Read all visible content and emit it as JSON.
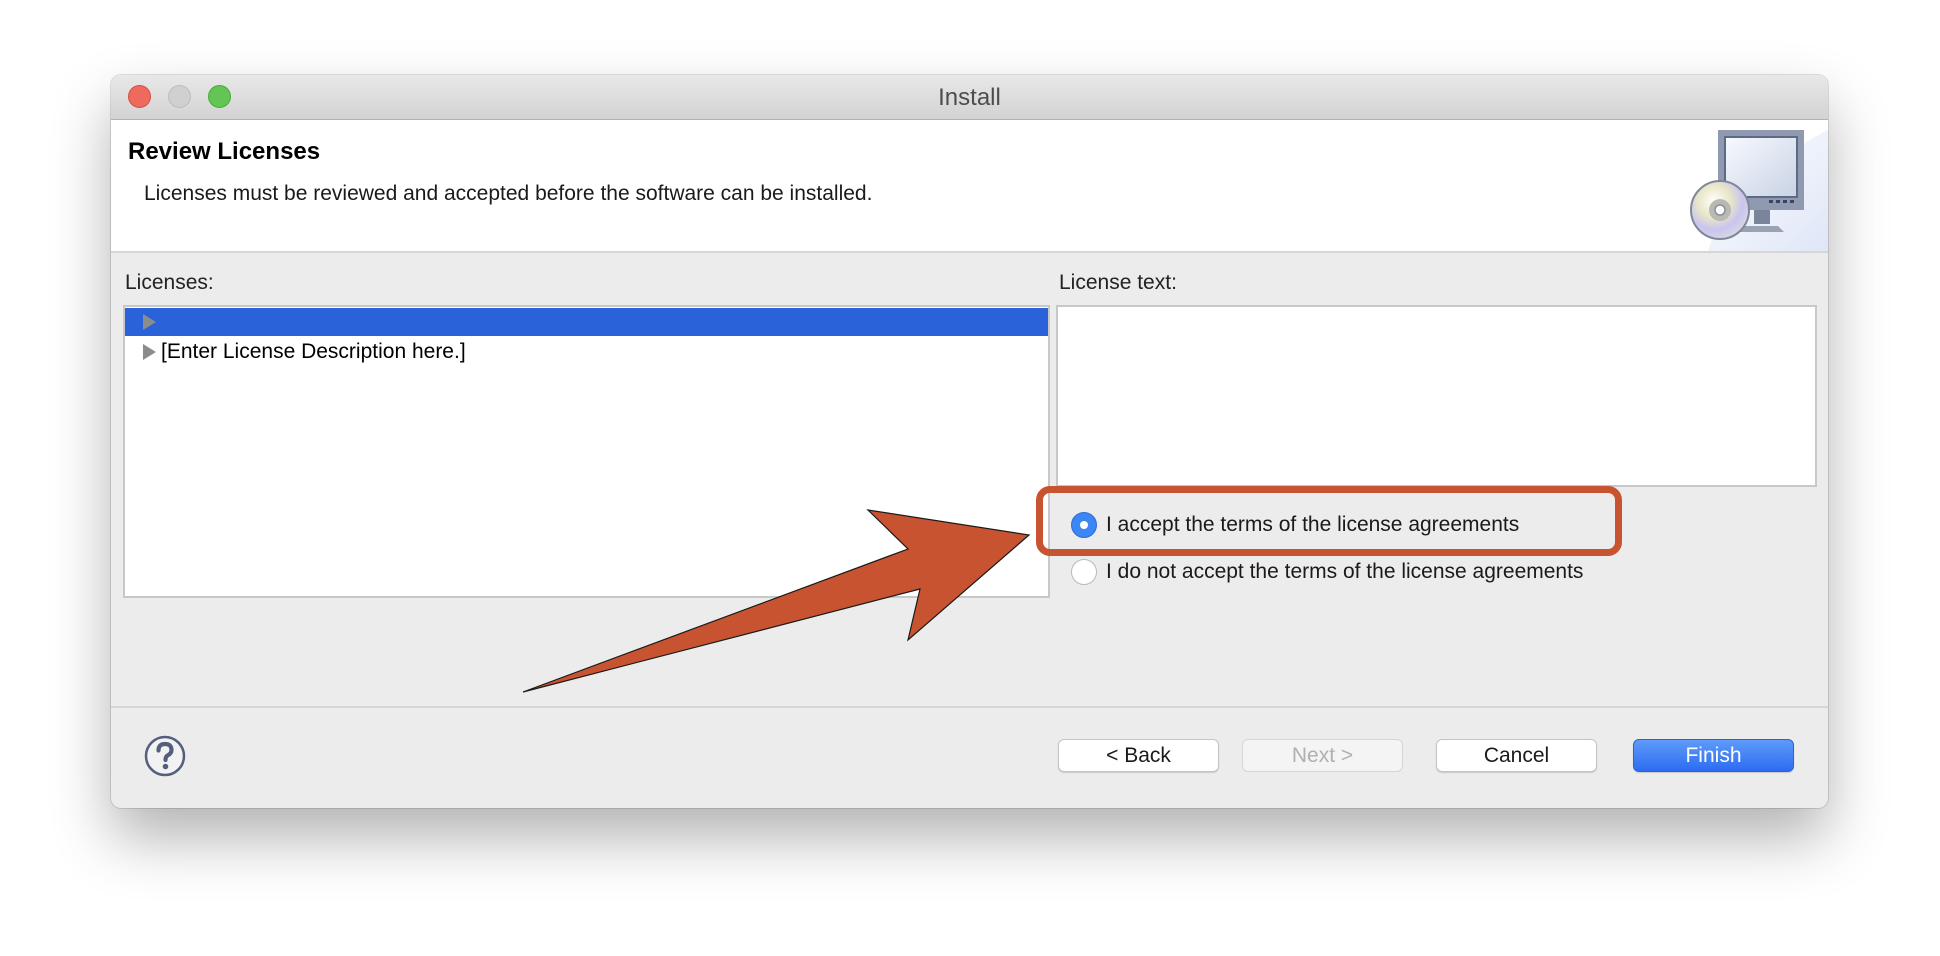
{
  "window": {
    "title": "Install",
    "traffic_lights": [
      "close",
      "minimize",
      "zoom"
    ]
  },
  "header": {
    "title": "Review Licenses",
    "description": "Licenses must be reviewed and accepted before the software can be installed.",
    "icon": "install-computer-cd-icon"
  },
  "licenses": {
    "label": "Licenses:",
    "items": [
      {
        "label": "",
        "selected": true,
        "expander": "triangle-right-icon"
      },
      {
        "label": "[Enter License Description here.]",
        "selected": false,
        "expander": "triangle-right-icon"
      }
    ]
  },
  "license_text": {
    "label": "License text:",
    "value": ""
  },
  "acceptance": {
    "options": [
      {
        "label": "I accept the terms of the license agreements",
        "checked": true
      },
      {
        "label": "I do not accept the terms of the license agreements",
        "checked": false
      }
    ]
  },
  "annotation": {
    "color": "#c85331",
    "type": "arrow-and-highlight"
  },
  "footer": {
    "help_icon": "question-mark-icon",
    "buttons": {
      "back": "< Back",
      "next": "Next >",
      "cancel": "Cancel",
      "finish": "Finish"
    },
    "next_enabled": false,
    "primary_color": "#2d6cf2"
  },
  "colors": {
    "selection": "#2a62d9",
    "radio_on": "#3d86f6"
  }
}
